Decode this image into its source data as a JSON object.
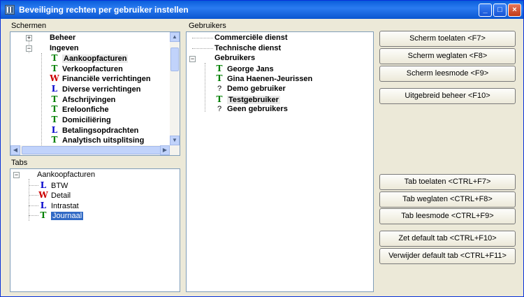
{
  "window": {
    "title": "Beveiliging rechten per gebruiker instellen"
  },
  "schermen": {
    "label": "Schermen",
    "items": [
      {
        "label": "Beheer",
        "icon": "",
        "expander": "+"
      },
      {
        "label": "Ingeven",
        "icon": "",
        "expander": "−"
      },
      {
        "label": "Aankoopfacturen",
        "icon": "T"
      },
      {
        "label": "Verkoopfacturen",
        "icon": "T"
      },
      {
        "label": "Financiële verrichtingen",
        "icon": "W"
      },
      {
        "label": "Diverse verrichtingen",
        "icon": "L"
      },
      {
        "label": "Afschrijvingen",
        "icon": "T"
      },
      {
        "label": "Ereloonfiche",
        "icon": "T"
      },
      {
        "label": "Domiciliëring",
        "icon": "T"
      },
      {
        "label": "Betalingsopdrachten",
        "icon": "L"
      },
      {
        "label": "Analytisch uitsplitsing",
        "icon": "T"
      }
    ]
  },
  "tabs": {
    "label": "Tabs",
    "root": "Aankoopfacturen",
    "items": [
      {
        "label": "BTW",
        "icon": "L"
      },
      {
        "label": "Detail",
        "icon": "W"
      },
      {
        "label": "Intrastat",
        "icon": "L"
      },
      {
        "label": "Journaal",
        "icon": "T"
      }
    ]
  },
  "gebruikers": {
    "label": "Gebruikers",
    "items": [
      {
        "label": "Commerciële dienst"
      },
      {
        "label": "Technische dienst"
      },
      {
        "label": "Gebruikers"
      },
      {
        "label": "George Jans",
        "icon": "T"
      },
      {
        "label": "Gina Haenen-Jeurissen",
        "icon": "T"
      },
      {
        "label": "Demo gebruiker",
        "icon": "?"
      },
      {
        "label": "Testgebruiker",
        "icon": "T"
      },
      {
        "label": "Geen gebruikers",
        "icon": "?"
      }
    ]
  },
  "buttons": {
    "scherm_toelaten": "Scherm toelaten <F7>",
    "scherm_weglaten": "Scherm weglaten <F8>",
    "scherm_leesmode": "Scherm leesmode <F9>",
    "uitgebreid_beheer": "Uitgebreid beheer <F10>",
    "tab_toelaten": "Tab toelaten <CTRL+F7>",
    "tab_weglaten": "Tab weglaten <CTRL+F8>",
    "tab_leesmode": "Tab leesmode <CTRL+F9>",
    "zet_default_tab": "Zet default tab <CTRL+F10>",
    "verwijder_default_tab": "Verwijder default tab <CTRL+F11>"
  },
  "title_buttons": {
    "minimize": "_",
    "maximize": "□",
    "close": "×"
  },
  "scroll_arrows": {
    "up": "▲",
    "down": "▼",
    "left": "◀",
    "right": "▶"
  }
}
